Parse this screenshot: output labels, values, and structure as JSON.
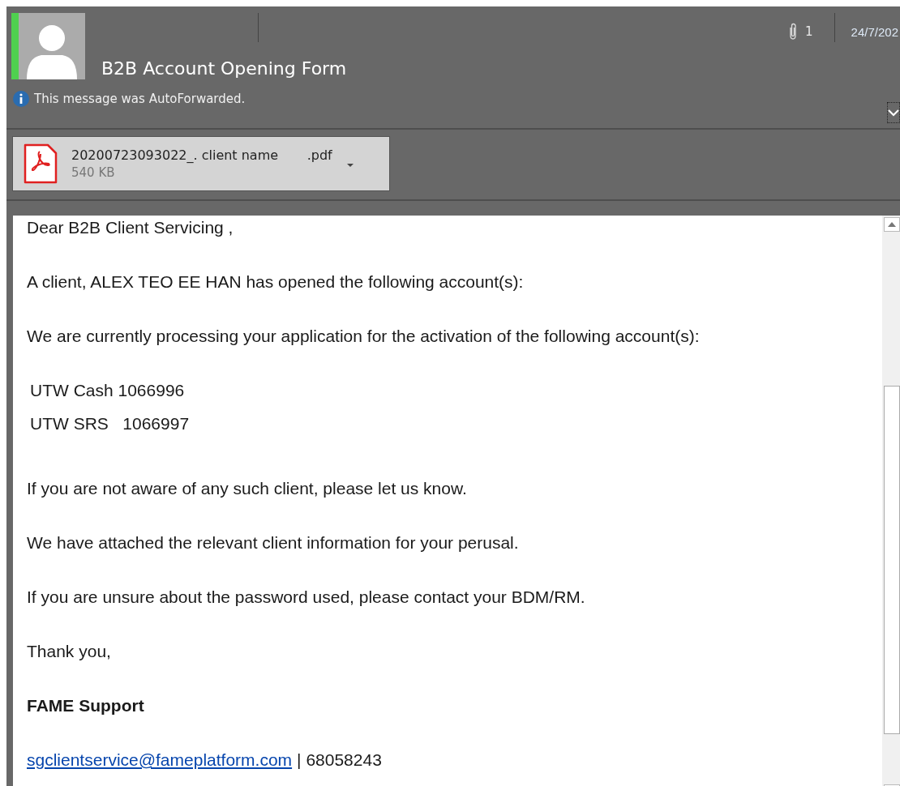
{
  "header": {
    "subject": "B2B Account Opening Form",
    "notice": "This message was AutoForwarded.",
    "attachment_count": "1",
    "date": "24/7/202"
  },
  "attachments": [
    {
      "name": "20200723093022_. client name       .pdf",
      "size": "540 KB"
    }
  ],
  "body": [
    {
      "kind": "text",
      "text": "Dear B2B Client Servicing ,"
    },
    {
      "kind": "text",
      "text": "A client, ALEX TEO EE HAN has opened the following account(s):"
    },
    {
      "kind": "text",
      "text": "We are currently processing your application for the activation of the following account(s):"
    },
    {
      "kind": "lines",
      "lines": [
        "UTW Cash 1066996",
        "UTW SRS   1066997"
      ]
    },
    {
      "kind": "text",
      "text": "If you are not aware of any such client, please let us know."
    },
    {
      "kind": "text",
      "text": "We have attached the relevant client information for your perusal."
    },
    {
      "kind": "text",
      "text": "If you are unsure about the password used, please contact your BDM/RM."
    },
    {
      "kind": "text",
      "text": "Thank you,"
    },
    {
      "kind": "bold",
      "text": "FAME Support"
    },
    {
      "kind": "contact",
      "link": "sgclientservice@fameplatform.com",
      "text": "| 68058243"
    }
  ]
}
